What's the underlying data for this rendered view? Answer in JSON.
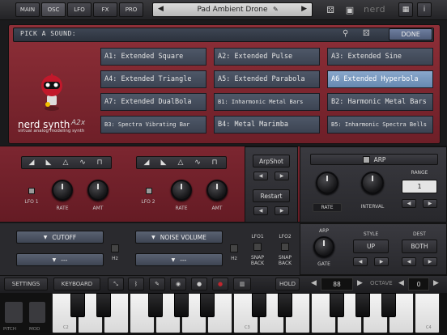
{
  "top": {
    "tabs": [
      {
        "label": "MAIN"
      },
      {
        "label": "OSC"
      },
      {
        "label": "LFO"
      },
      {
        "label": "FX"
      },
      {
        "label": "PRO"
      }
    ],
    "active_tab": "OSC",
    "preset_name": "Pad Ambient Drone",
    "brand": "nerd"
  },
  "browser": {
    "pick_label": "PICK A SOUND:",
    "done_label": "DONE",
    "presets": [
      "A1: Extended Square",
      "A2: Extended Pulse",
      "A3: Extended Sine",
      "A4: Extended Triangle",
      "A5: Extended Parabola",
      "A6 Extended Hyperbola",
      "A7: Extended DualBola",
      "B1: Inharmonic Metal Bars",
      "B2: Harmonic Metal Bars",
      "B3: Spectra Vibrating Bar",
      "B4: Metal Marimba",
      "B5: Inharmonic Spectra Bells"
    ],
    "selected_index": 5
  },
  "logo": {
    "name": "nerd synth",
    "version": "A2x",
    "subtitle": "virtual analog modeling synth"
  },
  "lfo": {
    "lfo1_label": "LFO 1",
    "lfo2_label": "LFO 2",
    "rate_label": "RATE",
    "amt_label": "AMT",
    "arpshot_label": "ArpShot",
    "restart_label": "Restart",
    "arp_label": "ARP",
    "range_label": "RANGE",
    "range_value": "1",
    "interval_label": "INTERVAL",
    "arp_rate_label": "RATE"
  },
  "mod": {
    "dest1": "CUTOFF",
    "dest1_sub": "---",
    "dest2": "NOISE VOLUME",
    "dest2_sub": "---",
    "hz_label": "Hz",
    "lfo1_col": "LFO1",
    "lfo2_col": "LFO2",
    "snap_back": "SNAP BACK",
    "arp_gate_top": "ARP",
    "gate_label": "GATE",
    "style_label": "STYLE",
    "style_value": "UP",
    "dest_label": "DEST",
    "dest_value": "BOTH"
  },
  "toolbar": {
    "settings": "SETTINGS",
    "keyboard": "KEYBOARD",
    "hold": "HOLD",
    "tempo": "88",
    "octave_label": "OCTAVE",
    "octave_value": "0"
  },
  "keys": {
    "pitch": "PITCH",
    "mod": "MOD",
    "labels": [
      "C2",
      "C3",
      "C4"
    ]
  }
}
